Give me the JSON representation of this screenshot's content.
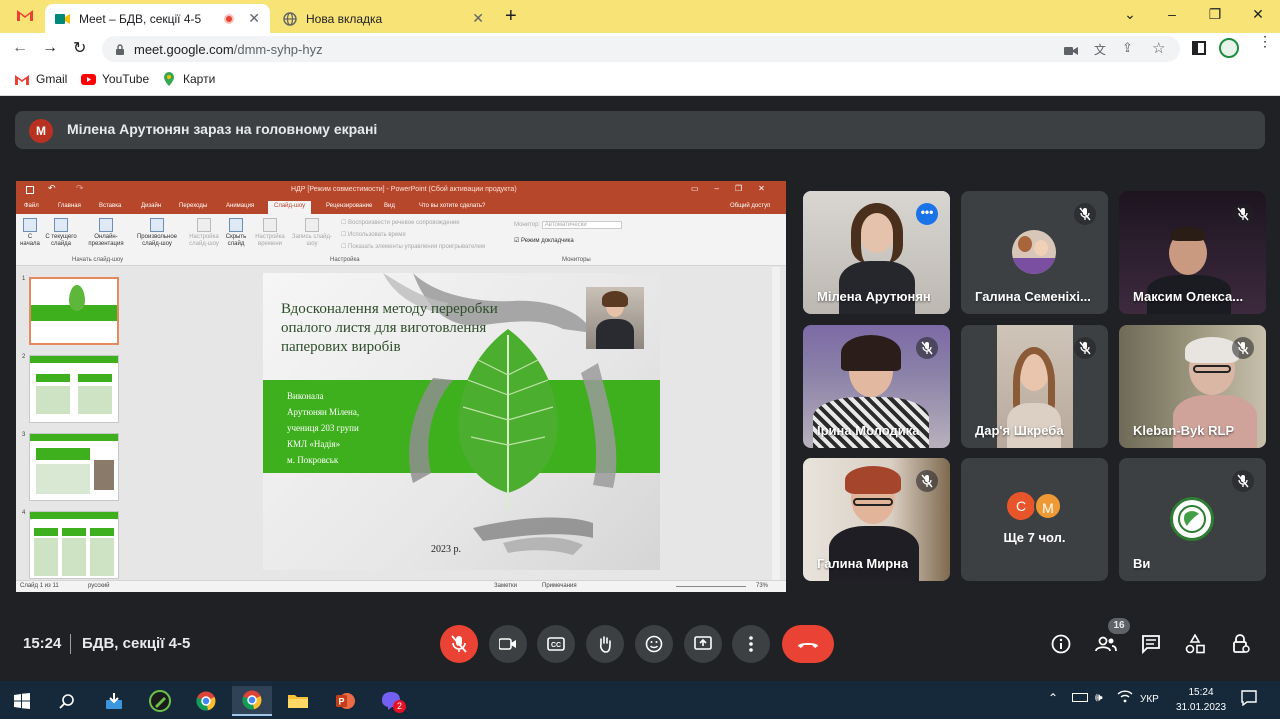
{
  "browser": {
    "tabs": [
      {
        "label": "Meet – БДВ, секції 4-5"
      },
      {
        "label": "Нова вкладка"
      }
    ],
    "url_host": "meet.google.com",
    "url_path": "/dmm-syhp-hyz",
    "bookmarks": [
      {
        "label": "Gmail"
      },
      {
        "label": "YouTube"
      },
      {
        "label": "Карти"
      }
    ]
  },
  "banner": {
    "avatar_letter": "М",
    "text": "Мілена Арутюнян зараз на головному екрані"
  },
  "presentation": {
    "window_title": "НДР [Режим совместимости] - PowerPoint (Сбой активации продукта)",
    "ribbon_tabs": [
      "Файл",
      "Главная",
      "Вставка",
      "Дизайн",
      "Переходы",
      "Анимация",
      "Слайд-шоу",
      "Рецензирование",
      "Вид",
      "Что вы хотите сделать?",
      "Общий доступ"
    ],
    "ribbon_buttons": [
      "С начала",
      "С текущего слайда",
      "Онлайн-презентация",
      "Произвольное слайд-шоу",
      "Настройка слайд-шоу",
      "Скрыть слайд",
      "Настройка времени",
      "Запись слайд-шоу"
    ],
    "checkboxes": [
      "Воспроизвести речевое сопровождение",
      "Использовать время",
      "Показать элементы управления проигрывателем",
      "Режим докладчика"
    ],
    "monitor_label": "Монитор:",
    "monitor_value": "Автоматически",
    "group_labels": [
      "Начать слайд-шоу",
      "Настройка",
      "Мониторы"
    ],
    "slide_numbers": [
      "1",
      "2",
      "3",
      "4"
    ],
    "slide": {
      "title": "Вдосконалення методу переробки опалого листя для виготовлення паперових виробів",
      "author_lines": [
        "Виконала",
        "Арутюнян Мілена,",
        "учениця 203 групи",
        "КМЛ «Надія»",
        "м. Покровськ"
      ],
      "year": "2023 р."
    },
    "status": {
      "slide_info": "Слайд 1 из 11",
      "language": "русский",
      "notes": "Заметки",
      "comments": "Примечания",
      "zoom": "73%"
    }
  },
  "participants": [
    {
      "name": "Мілена Арутюнян"
    },
    {
      "name": "Галина Семеніхі..."
    },
    {
      "name": "Максим Олекса..."
    },
    {
      "name": "Ірина Молодика"
    },
    {
      "name": "Дар'я Шкреба"
    },
    {
      "name": "Kleban-Byk RLP"
    },
    {
      "name": "Галина Мирна"
    },
    {
      "name": "Ще 7 чол.",
      "avatars": [
        "С",
        "М"
      ]
    },
    {
      "name": "Ви"
    }
  ],
  "meeting": {
    "time": "15:24",
    "name": "БДВ, секції 4-5",
    "people_count": "16"
  },
  "taskbar": {
    "language": "УКР",
    "time": "15:24",
    "date": "31.01.2023",
    "viber_badge": "2"
  },
  "colors": {
    "meet_bg": "#202124",
    "tile_bg": "#3c4043",
    "danger": "#ea4335",
    "chrome_tabbar": "#f8e476",
    "ppt_accent": "#b7472a",
    "slide_green": "#3fb01d"
  }
}
